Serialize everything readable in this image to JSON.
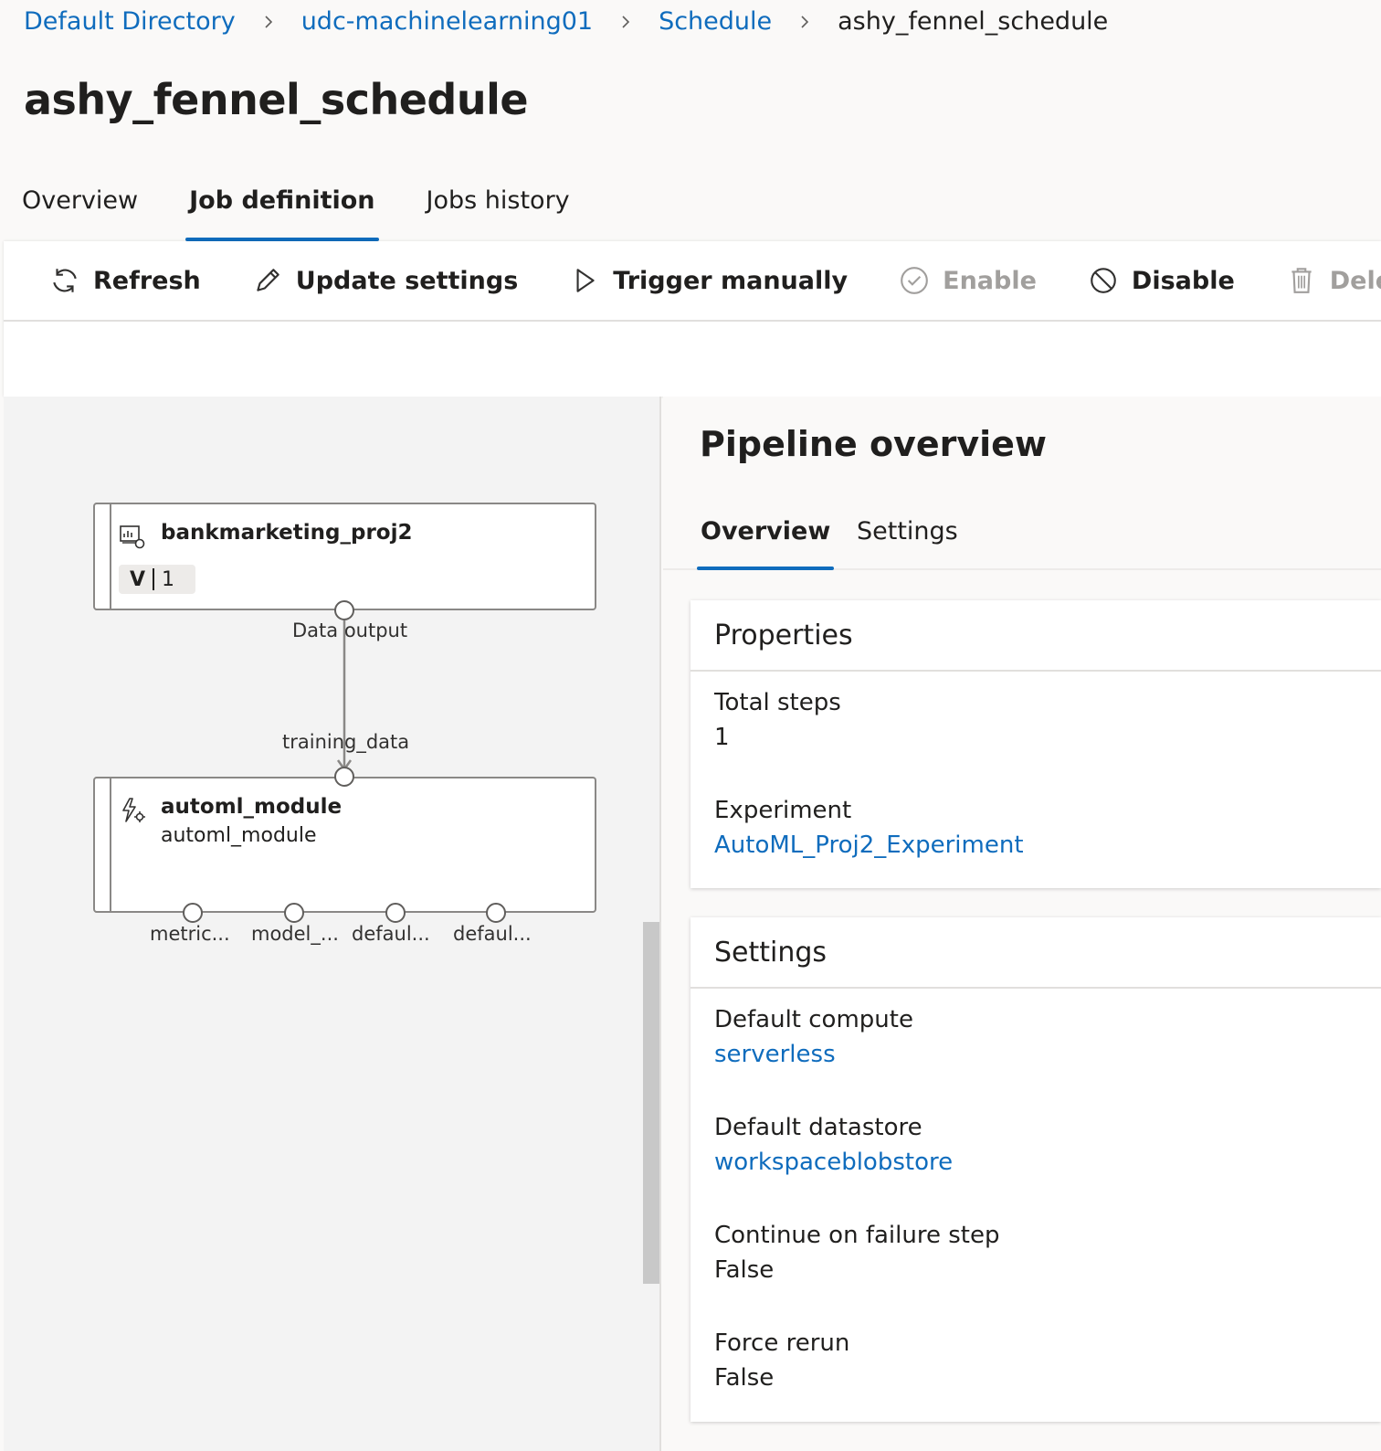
{
  "breadcrumb": {
    "items": [
      "Default Directory",
      "udc-machinelearning01",
      "Schedule"
    ],
    "current": "ashy_fennel_schedule"
  },
  "page": {
    "title": "ashy_fennel_schedule"
  },
  "tabs": [
    "Overview",
    "Job definition",
    "Jobs history"
  ],
  "active_tab": "Job definition",
  "toolbar": {
    "refresh": "Refresh",
    "update_settings": "Update settings",
    "trigger_manually": "Trigger manually",
    "enable": "Enable",
    "disable": "Disable",
    "delete": "Delete"
  },
  "pipeline": {
    "node1": {
      "title": "bankmarketing_proj2",
      "version_label": "V",
      "version": "1",
      "output_port": "Data output",
      "icon": "dataset-icon"
    },
    "node2": {
      "title": "automl_module",
      "subtitle": "automl_module",
      "input_port": "training_data",
      "icon": "automl-icon",
      "outputs": [
        "metric...",
        "model_...",
        "defaul...",
        "defaul..."
      ]
    }
  },
  "overview_panel": {
    "title": "Pipeline overview",
    "tabs": [
      "Overview",
      "Settings"
    ],
    "properties": {
      "header": "Properties",
      "total_steps_label": "Total steps",
      "total_steps": "1",
      "experiment_label": "Experiment",
      "experiment": "AutoML_Proj2_Experiment"
    },
    "settings": {
      "header": "Settings",
      "default_compute_label": "Default compute",
      "default_compute": "serverless",
      "default_datastore_label": "Default datastore",
      "default_datastore": "workspaceblobstore",
      "continue_on_failure_label": "Continue on failure step",
      "continue_on_failure": "False",
      "force_rerun_label": "Force rerun",
      "force_rerun": "False"
    }
  },
  "colors": {
    "accent": "#0f6cbd",
    "disabled": "#a19f9d"
  }
}
